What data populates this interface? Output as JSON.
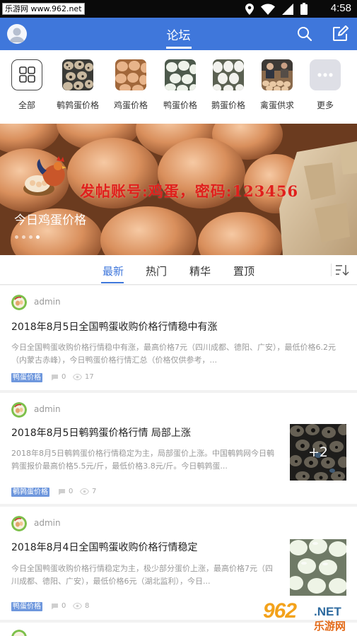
{
  "statusbar": {
    "watermark": "乐游网 www.962.net",
    "time": "4:58"
  },
  "header": {
    "title": "论坛"
  },
  "categories": [
    {
      "label": "全部",
      "icon": "grid-icon"
    },
    {
      "label": "鹌鹑蛋价格",
      "icon": "quail-egg-thumb"
    },
    {
      "label": "鸡蛋价格",
      "icon": "chicken-egg-thumb"
    },
    {
      "label": "鸭蛋价格",
      "icon": "duck-egg-thumb"
    },
    {
      "label": "鹅蛋价格",
      "icon": "goose-egg-thumb"
    },
    {
      "label": "禽蛋供求",
      "icon": "poultry-market-thumb"
    },
    {
      "label": "更多",
      "icon": "more-icon"
    }
  ],
  "banner": {
    "promo": "发帖账号:鸡蛋，密码:123456",
    "caption": "今日鸡蛋价格"
  },
  "tabs": [
    "最新",
    "热门",
    "精华",
    "置顶"
  ],
  "posts": [
    {
      "author": "admin",
      "title": "2018年8月5日全国鸭蛋收购价格行情稳中有涨",
      "excerpt": "今日全国鸭蛋收购价格行情稳中有涨，最高价格7元（四川成都、德阳、广安），最低价格6.2元（内蒙古赤峰），今日鸭蛋价格行情汇总（价格仅供参考，...",
      "tag": "鸭蛋价格",
      "comments": "0",
      "views": "17"
    },
    {
      "author": "admin",
      "title": "2018年8月5日鹌鹑蛋价格行情 局部上涨",
      "excerpt": "2018年8月5日鹌鹑蛋价格行情稳定为主，局部蛋价上涨。中国鹌鹑网今日鹌鹑蛋报价最高价格5.5元/斤，最低价格3.8元/斤。今日鹌鹑蛋...",
      "tag": "鹌鹑蛋价格",
      "comments": "0",
      "views": "7",
      "extra_images": "+2"
    },
    {
      "author": "admin",
      "title": "2018年8月4日全国鸭蛋收购价格行情稳定",
      "excerpt": "今日全国鸭蛋收购价格行情稳定为主，极少部分蛋价上涨，最高价格7元（四川成都、德阳、广安），最低价格6元（湖北监利），今日...",
      "tag": "鸭蛋价格",
      "comments": "0",
      "views": "8"
    }
  ],
  "watermark": {
    "brand": "962",
    "net": ".NET",
    "name": "乐游网"
  },
  "colors": {
    "primary": "#3f77db",
    "tag": "#6e97dd",
    "promo": "#e0201c"
  }
}
